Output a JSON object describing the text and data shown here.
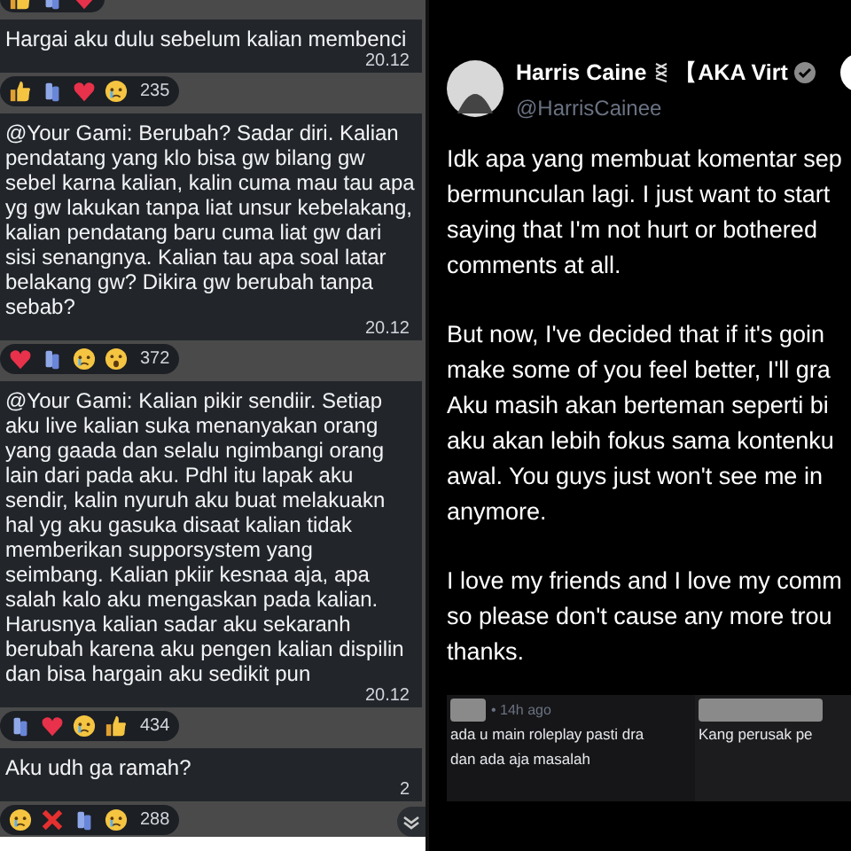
{
  "chat": {
    "top_reactions": [
      {
        "kind": "thumbs"
      },
      {
        "kind": "hands"
      },
      {
        "kind": "heart"
      }
    ],
    "messages": [
      {
        "text": "Hargai aku dulu sebelum kalian membenci",
        "time": "20.12",
        "reactions": [
          {
            "kind": "thumbs"
          },
          {
            "kind": "hands"
          },
          {
            "kind": "heart"
          },
          {
            "kind": "cry"
          }
        ],
        "count": "235"
      },
      {
        "text": "@Your Gami: Berubah? Sadar diri. Kalian pendatang yang klo bisa gw bilang gw sebel karna kalian, kalin cuma mau tau apa yg gw lakukan tanpa liat unsur kebelakang, kalian pendatang baru cuma liat gw dari sisi senangnya. Kalian tau apa soal latar belakang gw? Dikira gw berubah tanpa sebab?",
        "time": "20.12",
        "reactions": [
          {
            "kind": "heart"
          },
          {
            "kind": "hands"
          },
          {
            "kind": "cry"
          },
          {
            "kind": "shock"
          }
        ],
        "count": "372"
      },
      {
        "text": "@Your Gami: Kalian pikir sendiir. Setiap aku live kalian suka menanyakan orang yang gaada dan selalu ngimbangi orang lain dari pada aku. Pdhl itu lapak aku sendir, kalin nyuruh aku buat melakuakn hal yg aku gasuka disaat kalian tidak memberikan supporsystem yang seimbang. Kalian pkiir kesnaa aja, apa salah kalo aku mengaskan pada kalian. Harusnya kalian sadar aku sekaranh berubah karena aku pengen kalian dispilin dan bisa hargain aku sedikit pun",
        "time": "20.12",
        "reactions": [
          {
            "kind": "hands"
          },
          {
            "kind": "heart"
          },
          {
            "kind": "cry"
          },
          {
            "kind": "thumbs"
          }
        ],
        "count": "434"
      },
      {
        "text": "Aku udh ga ramah?",
        "time": "2",
        "reactions": [
          {
            "kind": "cry"
          },
          {
            "kind": "cross"
          },
          {
            "kind": "hands"
          },
          {
            "kind": "sad"
          }
        ],
        "count": "288"
      }
    ]
  },
  "post": {
    "name": "Harris Caine",
    "alias": "【AKA Virt",
    "handle": "@HarrisCainee",
    "paragraphs": [
      [
        "Idk apa yang membuat komentar sep",
        "bermunculan lagi. I just want to start",
        "saying that I'm not hurt or bothered",
        "comments at all."
      ],
      [
        "But now, I've decided that if it's goin",
        "make some of you feel better, I'll gra",
        "Aku masih akan berteman seperti bi",
        "aku akan lebih fokus sama kontenku",
        "awal. You guys just won't see me in",
        "anymore."
      ],
      [
        "I love my friends and I love my comm",
        "so please don't cause any more trou",
        "thanks."
      ]
    ],
    "comments": [
      {
        "time": "• 14h ago",
        "lines": [
          "ada u main roleplay pasti dra",
          "dan ada aja masalah"
        ]
      },
      {
        "lines": [
          "Kang perusak pe"
        ]
      }
    ]
  }
}
